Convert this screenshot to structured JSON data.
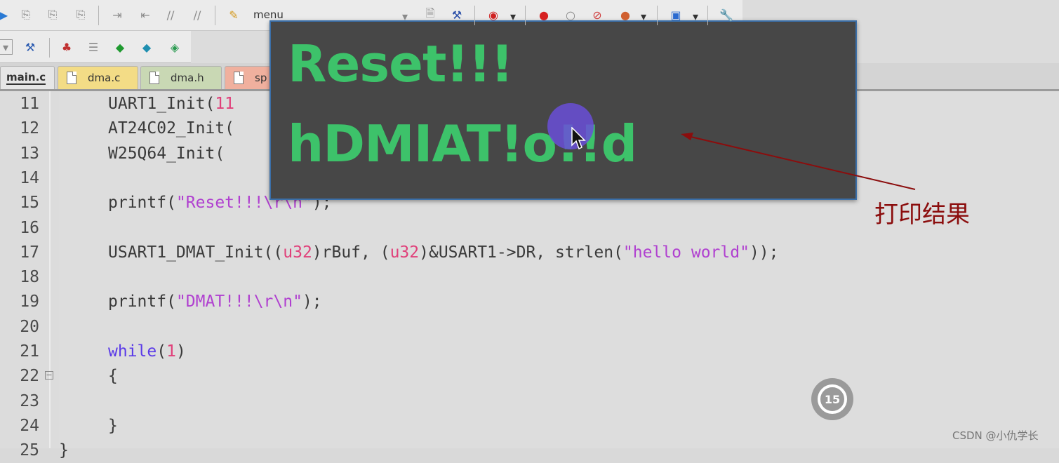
{
  "toolbar": {
    "menu_label": "menu"
  },
  "tabs": [
    {
      "label": "main.c",
      "active": true
    },
    {
      "label": "dma.c"
    },
    {
      "label": "dma.h"
    },
    {
      "label": "sp"
    }
  ],
  "editor": {
    "lines": [
      {
        "num": "11",
        "code": [
          {
            "t": "UART1_Init("
          },
          {
            "t": "11",
            "c": "num"
          }
        ]
      },
      {
        "num": "12",
        "code": [
          {
            "t": "AT24C02_Init("
          }
        ]
      },
      {
        "num": "13",
        "code": [
          {
            "t": "W25Q64_Init("
          }
        ]
      },
      {
        "num": "14",
        "code": []
      },
      {
        "num": "15",
        "code": [
          {
            "t": "printf("
          },
          {
            "t": "\"Reset!!!\\r\\n\"",
            "c": "str"
          },
          {
            "t": ");"
          }
        ]
      },
      {
        "num": "16",
        "code": []
      },
      {
        "num": "17",
        "code": [
          {
            "t": "USART1_DMAT_Init(("
          },
          {
            "t": "u32",
            "c": "num"
          },
          {
            "t": ")rBuf, ("
          },
          {
            "t": "u32",
            "c": "num"
          },
          {
            "t": ")&USART1->DR, strlen("
          },
          {
            "t": "\"hello world\"",
            "c": "str"
          },
          {
            "t": "));"
          }
        ]
      },
      {
        "num": "18",
        "code": []
      },
      {
        "num": "19",
        "code": [
          {
            "t": "printf("
          },
          {
            "t": "\"DMAT!!!\\r\\n\"",
            "c": "str"
          },
          {
            "t": ");"
          }
        ]
      },
      {
        "num": "20",
        "code": []
      },
      {
        "num": "21",
        "code": [
          {
            "t": "while",
            "c": "kw"
          },
          {
            "t": "("
          },
          {
            "t": "1",
            "c": "num"
          },
          {
            "t": ")"
          }
        ]
      },
      {
        "num": "22",
        "code": [
          {
            "t": "{"
          }
        ],
        "fold": "−"
      },
      {
        "num": "23",
        "code": []
      },
      {
        "num": "24",
        "code": [
          {
            "t": "}"
          }
        ]
      },
      {
        "num": "25",
        "code": [
          {
            "t": "}"
          }
        ]
      }
    ]
  },
  "terminal": {
    "lines": [
      "Reset!!!",
      "hDMIAT!o!!d"
    ]
  },
  "annotation": {
    "text": "打印结果",
    "color": "#8b0d0d"
  },
  "replay": {
    "label": "15"
  },
  "watermark": "CSDN @小仇学长"
}
